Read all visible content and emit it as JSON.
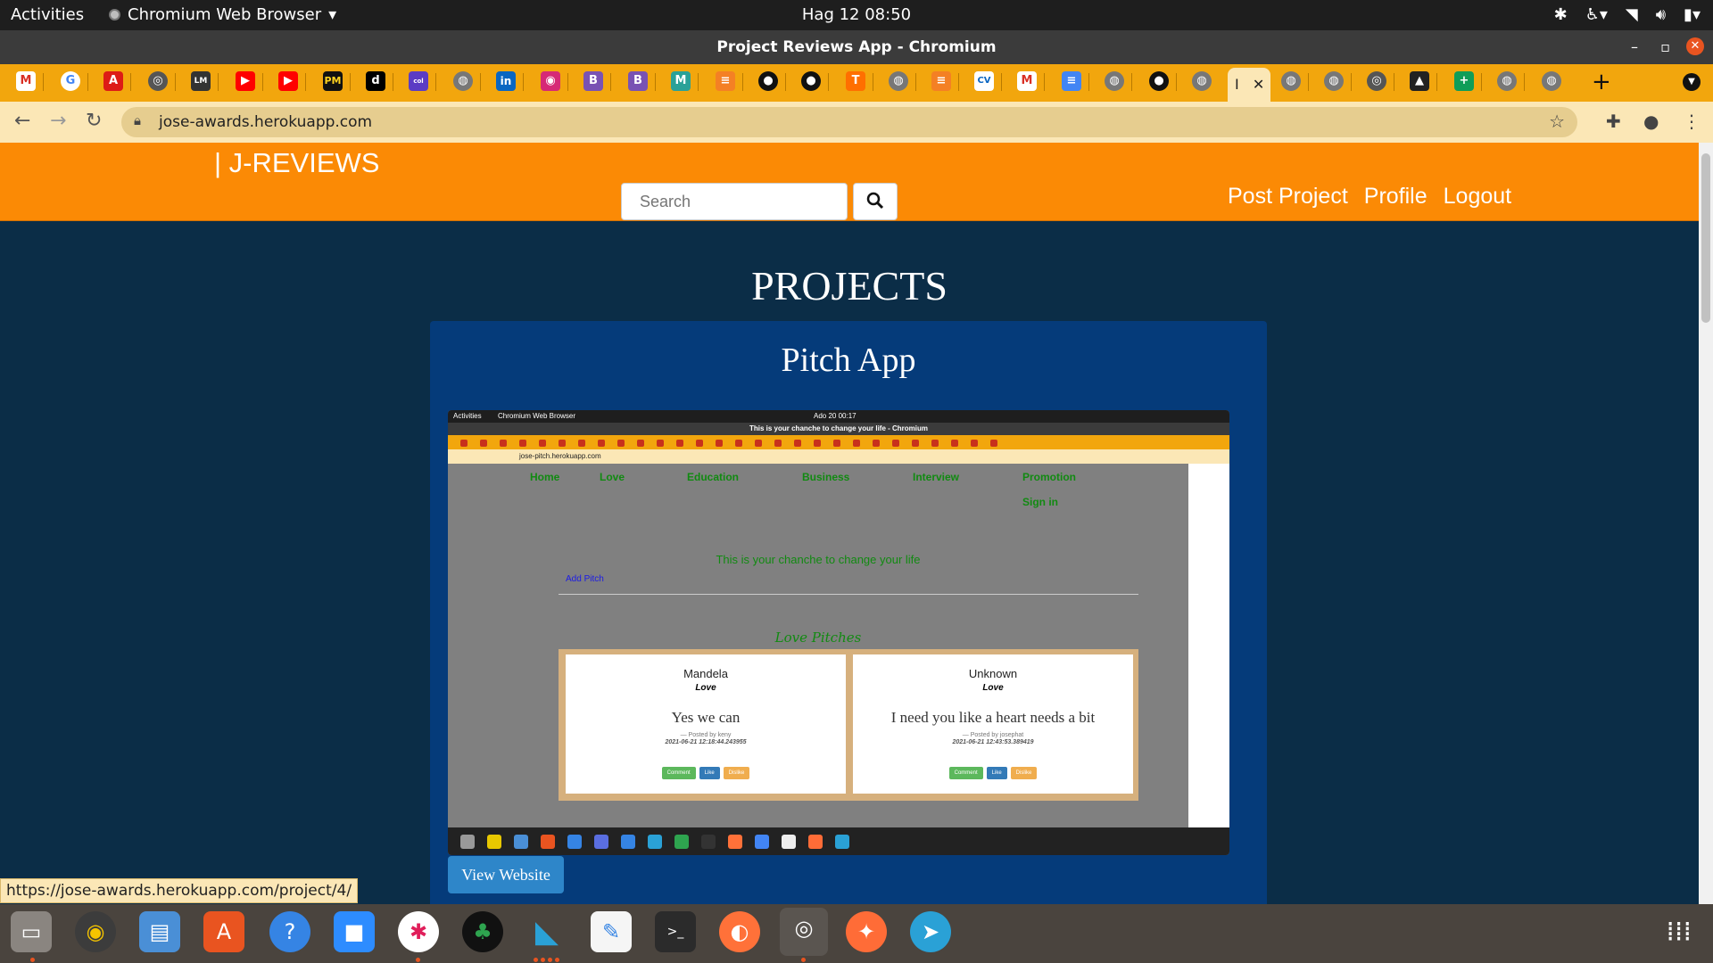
{
  "system": {
    "activities": "Activities",
    "app_name": "Chromium Web Browser",
    "clock": "Hag 12  08:50"
  },
  "window": {
    "title": "Project Reviews App - Chromium",
    "active_tab_label": "I"
  },
  "address_bar": {
    "url": "jose-awards.herokuapp.com"
  },
  "site": {
    "brand": "| J-REVIEWS",
    "search_placeholder": "Search",
    "nav_links": [
      "Post Project",
      "Profile",
      "Logout"
    ],
    "page_heading": "PROJECTS",
    "project": {
      "title": "Pitch App",
      "view_button": "View Website"
    }
  },
  "screenshot": {
    "top_left": "Activities",
    "browser": "Chromium Web Browser",
    "clock": "Ado 20  00:17",
    "window_title": "This is your chanche to change your life - Chromium",
    "url": "jose-pitch.herokuapp.com",
    "nav": [
      "Home",
      "Love",
      "Education",
      "Business",
      "Interview",
      "Promotion"
    ],
    "sign_in": "Sign in",
    "headline": "This is your chanche to change your life",
    "add_pitch": "Add Pitch",
    "section": "Love Pitches",
    "pitches": [
      {
        "author": "Mandela",
        "category": "Love",
        "body": "Yes we can",
        "posted_by": "— Posted by keny",
        "date": "2021-06-21 12:18:44.243955",
        "buttons": [
          "Comment",
          "Like",
          "Dislike"
        ]
      },
      {
        "author": "Unknown",
        "category": "Love",
        "body": "I need you like a heart needs a bit",
        "posted_by": "— Posted by josephat",
        "date": "2021-06-21 12:43:53.389419",
        "buttons": [
          "Comment",
          "Like",
          "Dislike"
        ]
      }
    ]
  },
  "status_url": "https://jose-awards.herokuapp.com/project/4/",
  "colors": {
    "navbar": "#fb8a05",
    "page_bg": "#0b2d47",
    "card_bg": "#053b7a",
    "tab_strip": "#f2a60d",
    "toolbar": "#fbe7b6"
  },
  "tab_icons": [
    "gmail-icon",
    "google-icon",
    "angular-icon",
    "chrome-icon",
    "lm-icon",
    "youtube-icon",
    "youtube-icon",
    "pm-icon",
    "dev-icon",
    "colorlib-icon",
    "globe-icon",
    "linkedin-icon",
    "instagram-icon",
    "bootstrap-icon",
    "bootstrap-icon",
    "moringa-icon",
    "stackoverflow-icon",
    "github-icon",
    "github-icon",
    "tf-icon",
    "globe-icon",
    "stackoverflow-icon",
    "cv-icon",
    "gmail-icon",
    "docs-icon",
    "globe-icon",
    "github-icon",
    "globe-icon"
  ],
  "dock_apps": [
    "files-icon",
    "rhythmbox-icon",
    "text-editor-icon",
    "software-center-icon",
    "help-icon",
    "zoom-icon",
    "slack-icon",
    "android-icon",
    "vscode-icon",
    "notes-icon",
    "terminal-icon",
    "firefox-icon",
    "chromium-icon",
    "postman-icon",
    "telegram-icon"
  ]
}
